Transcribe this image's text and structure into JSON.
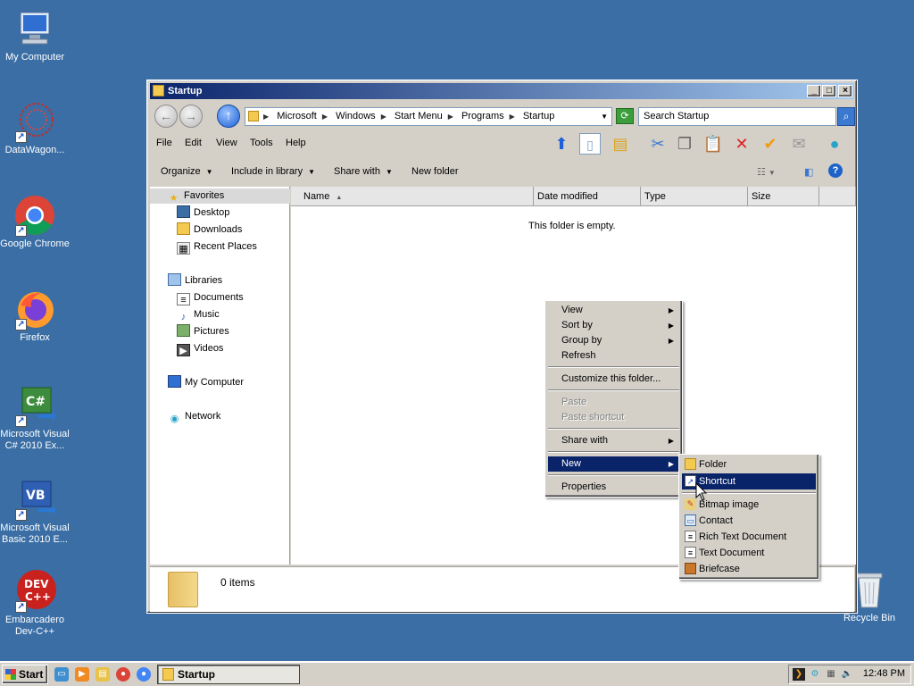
{
  "desktop": {
    "icons": [
      {
        "label": "My Computer"
      },
      {
        "label": "DataWagon..."
      },
      {
        "label": "Google Chrome"
      },
      {
        "label": "Firefox"
      },
      {
        "label": "Microsoft Visual C# 2010 Ex..."
      },
      {
        "label": "Microsoft Visual Basic 2010 E..."
      },
      {
        "label": "Embarcadero Dev-C++"
      },
      {
        "label": "Recycle Bin"
      }
    ]
  },
  "window": {
    "title": "Startup",
    "address": {
      "crumbs": [
        "Microsoft",
        "Windows",
        "Start Menu",
        "Programs",
        "Startup"
      ]
    },
    "search": {
      "placeholder": "Search Startup"
    },
    "menu": [
      "File",
      "Edit",
      "View",
      "Tools",
      "Help"
    ],
    "commands": {
      "organize": "Organize",
      "include": "Include in library",
      "share": "Share with",
      "new_folder": "New folder"
    },
    "nav": {
      "favorites": "Favorites",
      "desktop": "Desktop",
      "downloads": "Downloads",
      "recent": "Recent Places",
      "libraries": "Libraries",
      "documents": "Documents",
      "music": "Music",
      "pictures": "Pictures",
      "videos": "Videos",
      "computer": "My Computer",
      "network": "Network"
    },
    "columns": {
      "name": "Name",
      "modified": "Date modified",
      "type": "Type",
      "size": "Size"
    },
    "empty_message": "This folder is empty.",
    "status": "0 items"
  },
  "context_menu": {
    "view": "View",
    "sort_by": "Sort by",
    "group_by": "Group by",
    "refresh": "Refresh",
    "customize": "Customize this folder...",
    "paste": "Paste",
    "paste_shortcut": "Paste shortcut",
    "share_with": "Share with",
    "new": "New",
    "properties": "Properties"
  },
  "new_submenu": {
    "folder": "Folder",
    "shortcut": "Shortcut",
    "bitmap": "Bitmap image",
    "contact": "Contact",
    "rtf": "Rich Text Document",
    "text": "Text Document",
    "briefcase": "Briefcase"
  },
  "taskbar": {
    "start": "Start",
    "task": "Startup",
    "clock": "12:48 PM"
  }
}
